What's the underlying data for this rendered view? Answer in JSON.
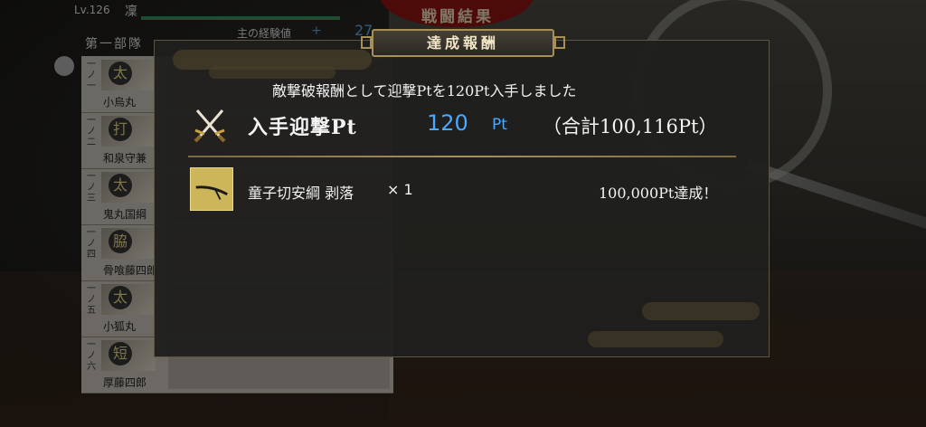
{
  "background": {
    "result_title": "戦闘結果",
    "level": "Lv.126",
    "player_name": "凜",
    "unit_label": "第一部隊",
    "exp_label": "主の経験値",
    "exp_plus": "+",
    "exp_value": "27",
    "roster": [
      {
        "slot": "一ノ一",
        "kanji": "太",
        "name": "小烏丸"
      },
      {
        "slot": "一ノ二",
        "kanji": "打",
        "name": "和泉守兼"
      },
      {
        "slot": "一ノ三",
        "kanji": "太",
        "name": "鬼丸国綱"
      },
      {
        "slot": "一ノ四",
        "kanji": "脇",
        "name": "骨喰藤四郎"
      },
      {
        "slot": "一ノ五",
        "kanji": "太",
        "name": "小狐丸"
      },
      {
        "slot": "一ノ六",
        "kanji": "短",
        "name": "厚藤四郎"
      }
    ]
  },
  "modal": {
    "title": "達成報酬",
    "message": "敵撃破報酬として迎撃Ptを120Pt入手しました",
    "points_label": "入手迎撃Pt",
    "points_value": "120",
    "points_unit": "Pt",
    "points_total": "（合計100,116Pt）",
    "reward": {
      "name": "童子切安綱 剥落",
      "quantity": "× 1",
      "condition": "100,000Pt達成！"
    }
  },
  "colors": {
    "accent_blue": "#4aa8ff",
    "frame_gold": "#a88f57",
    "modal_bg": "#1f1f1d"
  },
  "icons": {
    "points": "crossed-swords-icon",
    "reward": "sword-item-icon"
  }
}
